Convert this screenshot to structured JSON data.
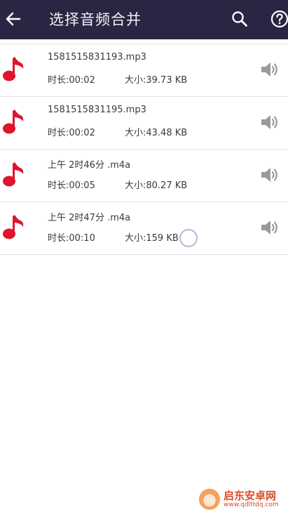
{
  "header": {
    "title": "选择音频合并",
    "back_icon": "arrow-left-icon",
    "search_icon": "search-icon",
    "help_icon": "help-circle-icon"
  },
  "files": [
    {
      "name": "1581515831193.mp3",
      "duration": "时长:00:02",
      "size": "大小:39.73 KB"
    },
    {
      "name": "1581515831195.mp3",
      "duration": "时长:00:02",
      "size": "大小:43.48 KB"
    },
    {
      "name": "上午 2时46分 .m4a",
      "duration": "时长:00:05",
      "size": "大小:80.27 KB"
    },
    {
      "name": "上午 2时47分 .m4a",
      "duration": "时长:00:10",
      "size": "大小:159 KB"
    }
  ],
  "icons": {
    "file": "music-note-icon",
    "play": "speaker-icon"
  },
  "colors": {
    "topbar": "#2b2442",
    "note": "#e0142c",
    "speaker": "#9a9a9a"
  },
  "watermark": {
    "name": "启东安卓网",
    "url": "www.qdlttdq.com"
  }
}
